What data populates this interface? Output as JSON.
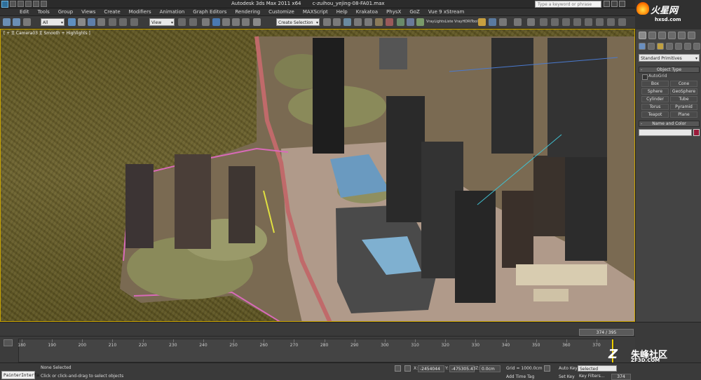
{
  "window": {
    "app_title": "Autodesk 3ds Max  2011 x64",
    "file_name": "c-zuihou_yejing-08-FA01.max",
    "search_placeholder": "Type a keyword or phrase"
  },
  "menu": [
    "Edit",
    "Tools",
    "Group",
    "Views",
    "Create",
    "Modifiers",
    "Animation",
    "Graph Editors",
    "Rendering",
    "Customize",
    "MAXScript",
    "Help",
    "Krakatoa",
    "PhysX",
    "GoZ",
    "Vue 9 xStream"
  ],
  "toolbar": {
    "filter_value": "All",
    "refcoord_value": "View",
    "named_selection_value": "Create Selection Se",
    "plugin_label": "VrayLightsListe VrayHDRITool"
  },
  "viewport": {
    "label": "[ + ][ Camera03 ][ Smooth + Highlights ]"
  },
  "command_panel": {
    "category": "Standard Primitives",
    "object_type_header": "Object Type",
    "autogrid_label": "AutoGrid",
    "primitives": [
      "Box",
      "Cone",
      "Sphere",
      "GeoSphere",
      "Cylinder",
      "Tube",
      "Torus",
      "Pyramid",
      "Teapot",
      "Plane"
    ],
    "name_color_header": "Name and Color",
    "object_color": "#9a1a3a"
  },
  "timeline": {
    "slider_label": "374 / 395",
    "frame_ticks": [
      "180",
      "190",
      "200",
      "210",
      "220",
      "230",
      "240",
      "250",
      "260",
      "270",
      "280",
      "290",
      "300",
      "310",
      "320",
      "330",
      "340",
      "350",
      "360",
      "370"
    ]
  },
  "status": {
    "listener_label": "PainterInterfa",
    "selection_info": "None Selected",
    "prompt": "Click or click-and-drag to select objects",
    "x_value": "-2454044",
    "y_value": "-475305.47",
    "z_value": "0.0cm",
    "grid": "Grid = 1000.0cm",
    "add_time_tag": "Add Time Tag",
    "auto_key": "Auto Key",
    "set_key": "Set Key",
    "key_mode": "Selected",
    "key_filters": "Key Filters...",
    "current_frame": "374"
  },
  "watermarks": {
    "top_cn": "火星网",
    "top_url": "hxsd.com",
    "bottom_cn": "朱峰社区",
    "bottom_url": "ZF3D.COM"
  }
}
